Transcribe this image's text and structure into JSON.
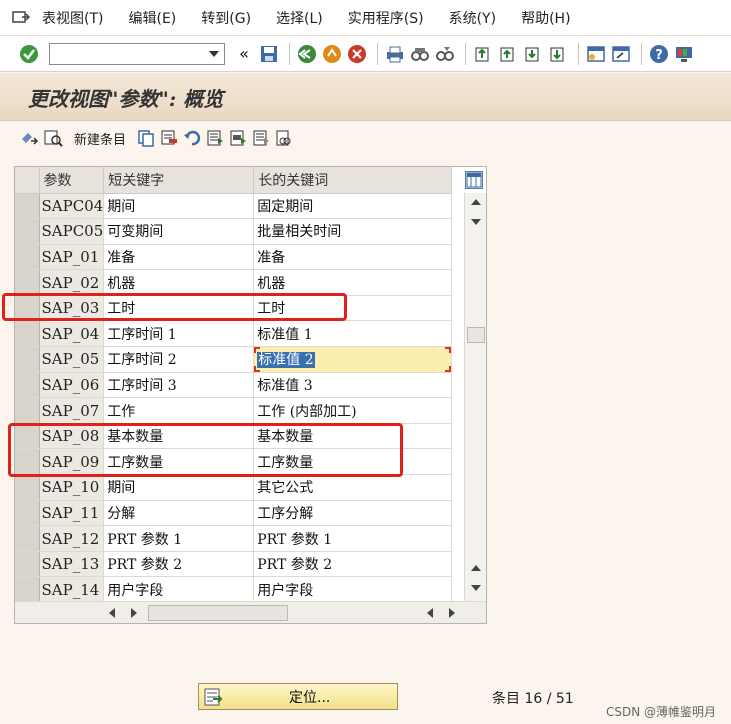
{
  "menu": {
    "items": [
      "表视图(T)",
      "编辑(E)",
      "转到(G)",
      "选择(L)",
      "实用程序(S)",
      "系统(Y)",
      "帮助(H)"
    ]
  },
  "toolbar": {
    "command_value": "",
    "icons": [
      "check-icon",
      "back-icon",
      "exit-icon",
      "cancel-icon",
      "print-icon",
      "find-icon",
      "find-next-icon",
      "first-page-icon",
      "prev-page-icon",
      "next-page-icon",
      "last-page-icon",
      "new-session-icon",
      "shortcut-icon",
      "help-icon",
      "layout-icon"
    ]
  },
  "title": "更改视图\"参数\": 概览",
  "app_toolbar": {
    "new_entries": "新建条目"
  },
  "table": {
    "headers": [
      "参数",
      "短关键字",
      "长的关键词"
    ],
    "rows": [
      {
        "key": "SAPC04",
        "short": "期间",
        "long": "固定期间"
      },
      {
        "key": "SAPC05",
        "short": "可变期间",
        "long": "批量相关时间"
      },
      {
        "key": "SAP_01",
        "short": "准备",
        "long": "准备"
      },
      {
        "key": "SAP_02",
        "short": "机器",
        "long": "机器"
      },
      {
        "key": "SAP_03",
        "short": "工时",
        "long": "工时"
      },
      {
        "key": "SAP_04",
        "short": "工序时间 1",
        "long": "标准值 1"
      },
      {
        "key": "SAP_05",
        "short": "工序时间 2",
        "long": "标准值 2"
      },
      {
        "key": "SAP_06",
        "short": "工序时间 3",
        "long": "标准值 3"
      },
      {
        "key": "SAP_07",
        "short": "工作",
        "long": "工作 (内部加工)"
      },
      {
        "key": "SAP_08",
        "short": "基本数量",
        "long": "基本数量"
      },
      {
        "key": "SAP_09",
        "short": "工序数量",
        "long": "工序数量"
      },
      {
        "key": "SAP_10",
        "short": "期间",
        "long": "其它公式"
      },
      {
        "key": "SAP_11",
        "short": "分解",
        "long": "工序分解"
      },
      {
        "key": "SAP_12",
        "short": "PRT 参数 1",
        "long": "PRT 参数 1"
      },
      {
        "key": "SAP_13",
        "short": "PRT 参数 2",
        "long": "PRT 参数 2"
      },
      {
        "key": "SAP_14",
        "short": "用户字段",
        "long": "用户字段"
      }
    ]
  },
  "bottom": {
    "locate_label": "定位...",
    "entries_label": "条目 16 / 51"
  },
  "watermark": "CSDN @薄帷鉴明月",
  "colors": {
    "highlight": "#e0201a",
    "focus_cell": "#fbeeb0"
  }
}
